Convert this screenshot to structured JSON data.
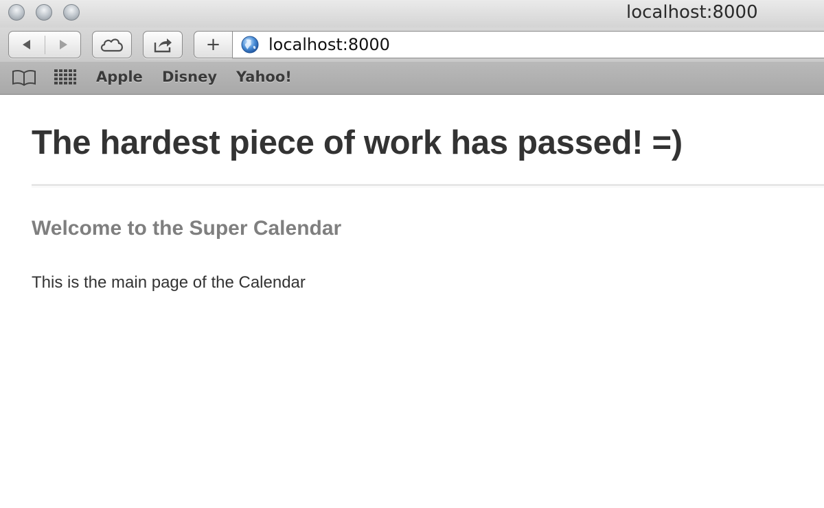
{
  "window": {
    "title": "localhost:8000"
  },
  "toolbar": {
    "back_icon": "back-arrow-icon",
    "forward_icon": "forward-arrow-icon",
    "icloud_icon": "cloud-icon",
    "share_icon": "share-icon",
    "add_label": "+",
    "address": "localhost:8000",
    "address_icon": "globe-icon"
  },
  "bookmarks": {
    "reading_list_icon": "book-icon",
    "top_sites_icon": "grid-icon",
    "items": [
      {
        "label": "Apple"
      },
      {
        "label": "Disney"
      },
      {
        "label": "Yahoo!"
      }
    ]
  },
  "page": {
    "heading": "The hardest piece of work has passed! =)",
    "subheading": "Welcome to the Super Calendar",
    "body": "This is the main page of the Calendar"
  },
  "colors": {
    "heading": "#333333",
    "subheading": "#7f7f7f",
    "body": "#333333",
    "bookmark_bar": "#b1b1b1"
  }
}
